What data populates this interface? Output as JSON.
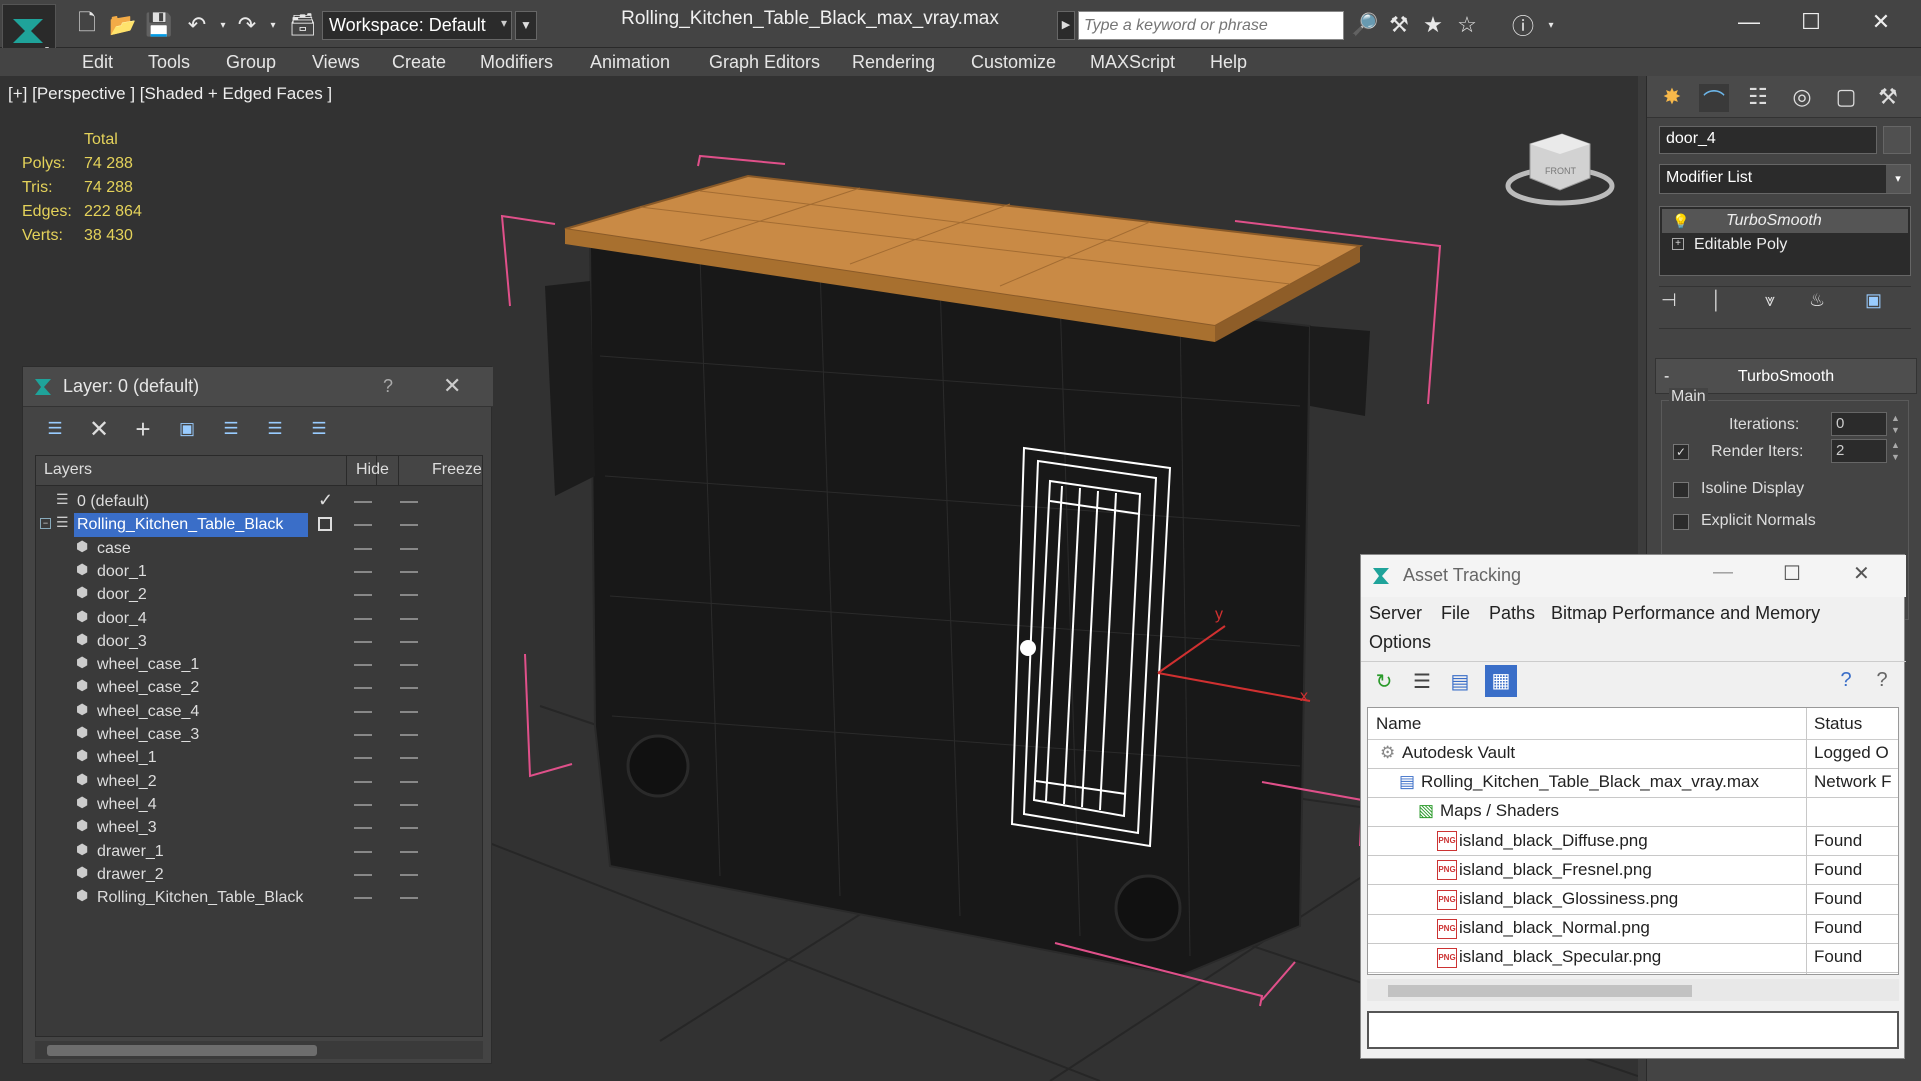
{
  "title_bar": {
    "workspace_label": "Workspace: Default",
    "file_title": "Rolling_Kitchen_Table_Black_max_vray.max",
    "search_placeholder": "Type a keyword or phrase"
  },
  "menu": [
    "Edit",
    "Tools",
    "Group",
    "Views",
    "Create",
    "Modifiers",
    "Animation",
    "Graph Editors",
    "Rendering",
    "Customize",
    "MAXScript",
    "Help"
  ],
  "viewport": {
    "label": "[+] [Perspective ] [Shaded + Edged Faces ]",
    "stats": {
      "header": "Total",
      "rows": [
        {
          "label": "Polys:",
          "value": "74 288"
        },
        {
          "label": "Tris:",
          "value": "74 288"
        },
        {
          "label": "Edges:",
          "value": "222 864"
        },
        {
          "label": "Verts:",
          "value": "38 430"
        }
      ]
    },
    "axis_y": "y",
    "axis_x": "x",
    "viewcube_label": "FRONT"
  },
  "layer_panel": {
    "title": "Layer: 0 (default)",
    "help": "?",
    "columns": {
      "layers": "Layers",
      "hide": "Hide",
      "freeze": "Freeze"
    },
    "rows": [
      {
        "name": "0 (default)",
        "type": "layer"
      },
      {
        "name": "Rolling_Kitchen_Table_Black",
        "type": "layer",
        "selected": true
      },
      {
        "name": "case",
        "type": "object"
      },
      {
        "name": "door_1",
        "type": "object"
      },
      {
        "name": "door_2",
        "type": "object"
      },
      {
        "name": "door_4",
        "type": "object"
      },
      {
        "name": "door_3",
        "type": "object"
      },
      {
        "name": "wheel_case_1",
        "type": "object"
      },
      {
        "name": "wheel_case_2",
        "type": "object"
      },
      {
        "name": "wheel_case_4",
        "type": "object"
      },
      {
        "name": "wheel_case_3",
        "type": "object"
      },
      {
        "name": "wheel_1",
        "type": "object"
      },
      {
        "name": "wheel_2",
        "type": "object"
      },
      {
        "name": "wheel_4",
        "type": "object"
      },
      {
        "name": "wheel_3",
        "type": "object"
      },
      {
        "name": "drawer_1",
        "type": "object"
      },
      {
        "name": "drawer_2",
        "type": "object"
      },
      {
        "name": "Rolling_Kitchen_Table_Black",
        "type": "object"
      }
    ]
  },
  "command_panel": {
    "object_name": "door_4",
    "modifier_list": "Modifier List",
    "stack": [
      "TurboSmooth",
      "Editable Poly"
    ],
    "rollout_title": "TurboSmooth",
    "group_main": "Main",
    "iterations_label": "Iterations:",
    "iterations_value": "0",
    "render_iters_label": "Render Iters:",
    "render_iters_value": "2",
    "isoline_label": "Isoline Display",
    "explicit_normals_label": "Explicit Normals"
  },
  "asset_tracking": {
    "title": "Asset Tracking",
    "menu": [
      "Server",
      "File",
      "Paths",
      "Bitmap Performance and Memory",
      "Options"
    ],
    "columns": {
      "name": "Name",
      "status": "Status"
    },
    "rows": [
      {
        "name": "Autodesk Vault",
        "status": "Logged O",
        "indent": 1,
        "icon": "vault"
      },
      {
        "name": "Rolling_Kitchen_Table_Black_max_vray.max",
        "status": "Network F",
        "indent": 2,
        "icon": "max"
      },
      {
        "name": "Maps / Shaders",
        "status": "",
        "indent": 3,
        "icon": "maps"
      },
      {
        "name": "island_black_Diffuse.png",
        "status": "Found",
        "indent": 4,
        "icon": "png"
      },
      {
        "name": "island_black_Fresnel.png",
        "status": "Found",
        "indent": 4,
        "icon": "png"
      },
      {
        "name": "island_black_Glossiness.png",
        "status": "Found",
        "indent": 4,
        "icon": "png"
      },
      {
        "name": "island_black_Normal.png",
        "status": "Found",
        "indent": 4,
        "icon": "png"
      },
      {
        "name": "island_black_Specular.png",
        "status": "Found",
        "indent": 4,
        "icon": "png"
      }
    ]
  },
  "colors": {
    "stats_text": "#e4d25a",
    "selection_blue": "#3a6ec8",
    "bounding_box_pink": "#e0508a",
    "tabletop_wood": "#c98a45"
  }
}
